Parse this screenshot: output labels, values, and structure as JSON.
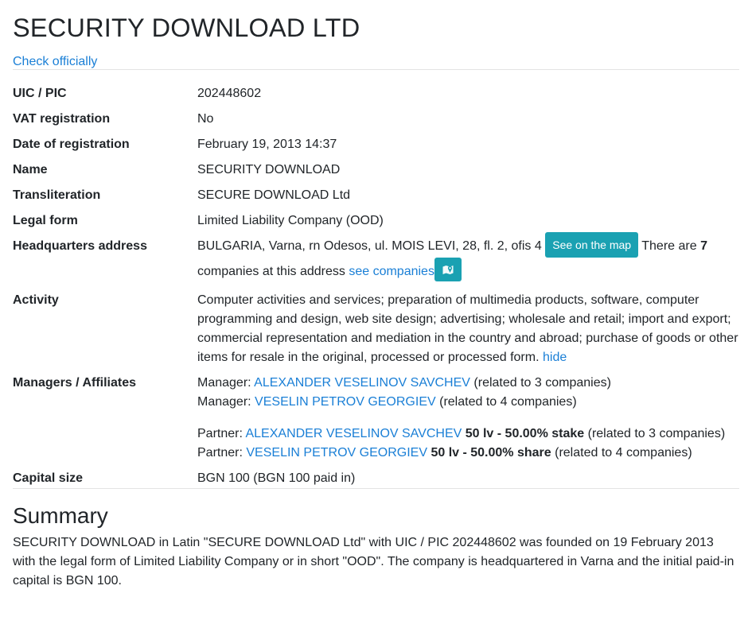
{
  "company": {
    "title": "SECURITY DOWNLOAD LTD",
    "check_link": "Check officially"
  },
  "fields": {
    "uic": {
      "label": "UIC / PIC",
      "value": "202448602"
    },
    "vat": {
      "label": "VAT registration",
      "value": "No"
    },
    "date": {
      "label": "Date of registration",
      "value": "February 19, 2013 14:37"
    },
    "name": {
      "label": "Name",
      "value": "SECURITY DOWNLOAD"
    },
    "translit": {
      "label": "Transliteration",
      "value": "SECURE DOWNLOAD Ltd"
    },
    "legal_form": {
      "label": "Legal form",
      "value": "Limited Liability Company (OOD)"
    },
    "hq": {
      "label": "Headquarters address",
      "address": "BULGARIA, Varna, rn Odesos, ul. MOIS LEVI, 28, fl. 2, ofis 4",
      "map_button": "See on the map",
      "there_are": "There are",
      "count": "7",
      "companies_text": "companies at this address",
      "see_companies": "see companies"
    },
    "activity": {
      "label": "Activity",
      "text": "Computer activities and services; preparation of multimedia products, software, computer programming and design, web site design; advertising; wholesale and retail; import and export; commercial representation and mediation in the country and abroad; purchase of goods or other items for resale in the original, processed or processed form.",
      "hide": "hide"
    },
    "managers": {
      "label": "Managers / Affiliates",
      "manager_prefix": "Manager:",
      "partner_prefix": "Partner:",
      "managers": [
        {
          "name": "ALEXANDER VESELINOV SAVCHEV",
          "related": "(related to 3 companies)"
        },
        {
          "name": "VESELIN PETROV GEORGIEV",
          "related": "(related to 4 companies)"
        }
      ],
      "partners": [
        {
          "name": "ALEXANDER VESELINOV SAVCHEV",
          "stake": "50 lv - 50.00% stake",
          "related": "(related to 3 companies)"
        },
        {
          "name": "VESELIN PETROV GEORGIEV",
          "stake": "50 lv - 50.00% share",
          "related": "(related to 4 companies)"
        }
      ]
    },
    "capital": {
      "label": "Capital size",
      "value": "BGN 100 (BGN 100 paid in)"
    }
  },
  "summary": {
    "heading": "Summary",
    "text": "SECURITY DOWNLOAD in Latin \"SECURE DOWNLOAD Ltd\" with UIC / PIC 202448602 was founded on 19 February 2013 with the legal form of Limited Liability Company or in short \"OOD\". The company is headquartered in Varna and the initial paid-in capital is BGN 100."
  },
  "colors": {
    "link": "#1a7fd6",
    "button": "#1aa1b2"
  },
  "icons": {
    "map_icon": "map-marker-icon"
  }
}
